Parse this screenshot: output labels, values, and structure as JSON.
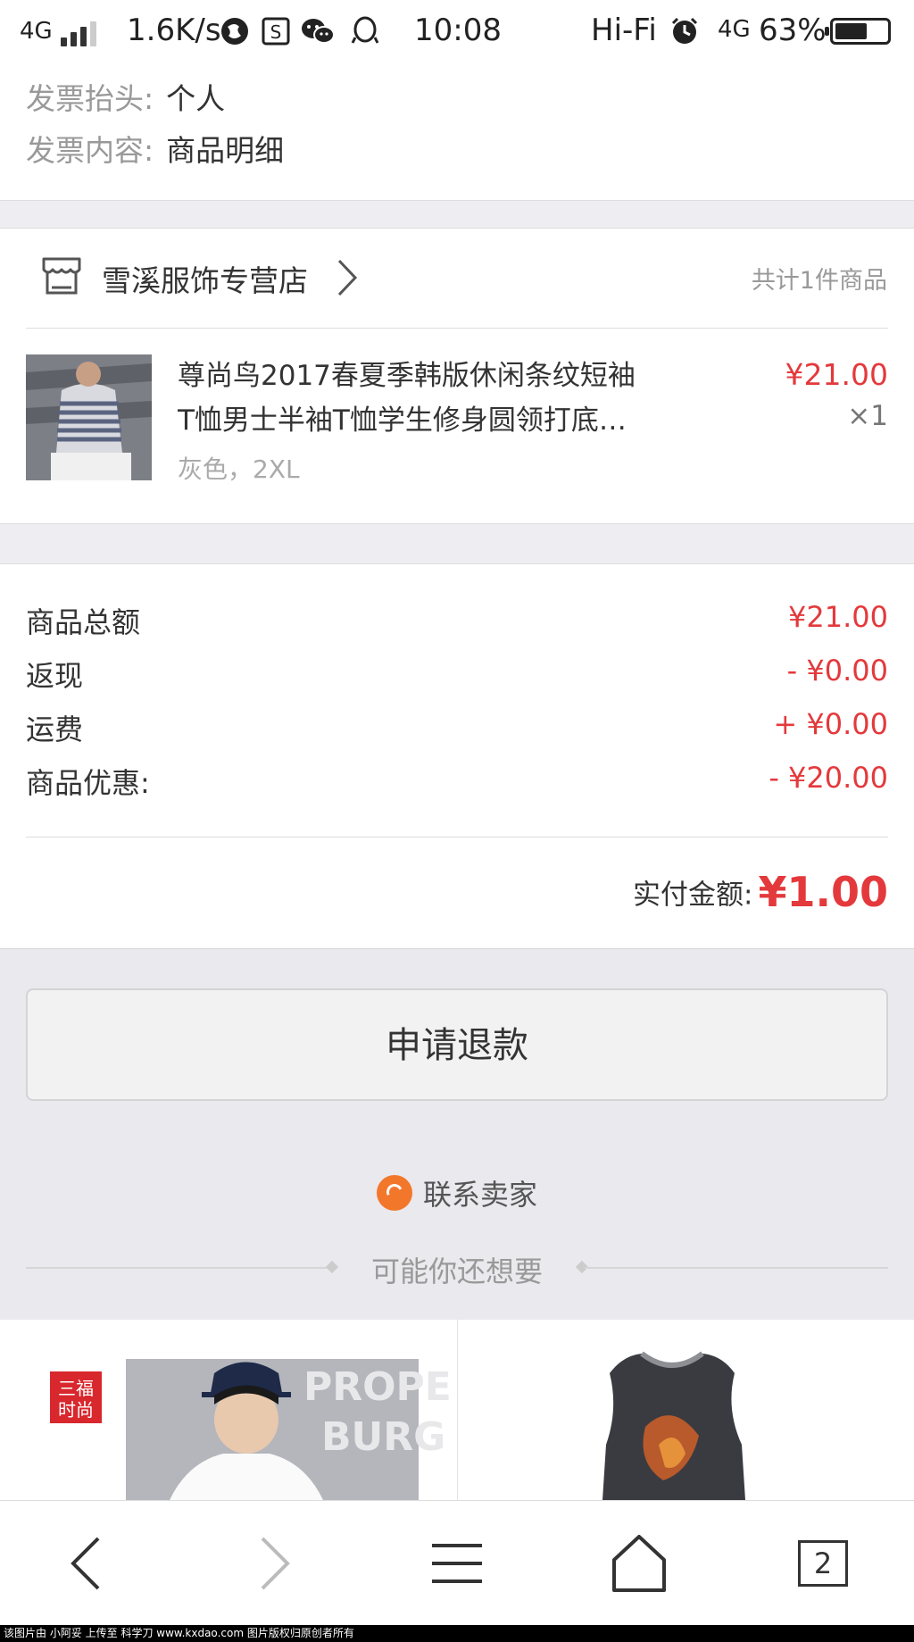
{
  "status_bar": {
    "network": "4G",
    "speed": "1.6K/s",
    "time": "10:08",
    "hifi": "Hi-Fi",
    "network_right": "4G",
    "battery": "63%",
    "battery_level": 0.63
  },
  "invoice": {
    "title_label": "发票抬头:",
    "title_value": "个人",
    "content_label": "发票内容:",
    "content_value": "商品明细"
  },
  "shop": {
    "store_name": "雪溪服饰专营店",
    "item_count": "共计1件商品"
  },
  "product": {
    "title_line1": "尊尚鸟2017春夏季韩版休闲条纹短袖",
    "title_line2": "T恤男士半袖T恤学生修身圆领打底…",
    "variant": "灰色，2XL",
    "price": "¥21.00",
    "quantity": "×1"
  },
  "summary": {
    "rows": [
      {
        "label": "商品总额",
        "value": "¥21.00"
      },
      {
        "label": "返现",
        "value": "- ¥0.00"
      },
      {
        "label": "运费",
        "value": "+ ¥0.00"
      },
      {
        "label": "商品优惠:",
        "value": "- ¥20.00"
      }
    ],
    "paid_label": "实付金额:",
    "paid_value": "¥1.00"
  },
  "actions": {
    "refund_button": "申请退款",
    "contact_seller": "联系卖家",
    "recommend_title": "可能你还想要"
  },
  "recommended": {
    "badge_line1": "三福",
    "badge_line2": "时尚",
    "shirt_text_1": "PROPE",
    "shirt_text_2": "BURG"
  },
  "bottom_nav": {
    "tab_count": "2"
  },
  "watermark": "该图片由 小阿妥 上传至 科学刀 www.kxdao.com 图片版权归原创者所有",
  "colors": {
    "accent_red": "#e4393c",
    "contact_orange": "#f2772b",
    "background_gray": "#e9e9ee"
  }
}
